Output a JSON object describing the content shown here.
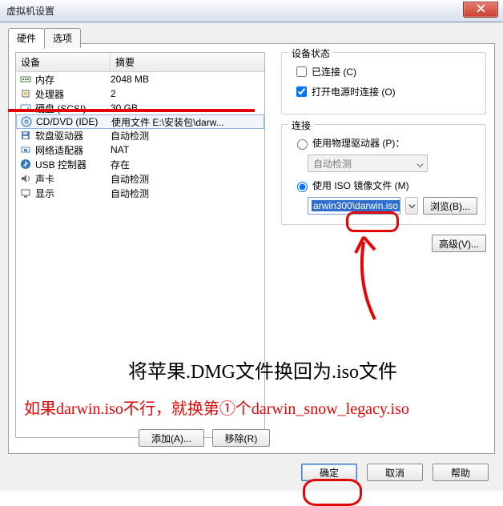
{
  "window": {
    "title": "虚拟机设置"
  },
  "tabs": {
    "hardware": "硬件",
    "options": "选项"
  },
  "device_list": {
    "head_device": "设备",
    "head_summary": "摘要",
    "rows": [
      {
        "name": "内存",
        "summary": "2048 MB",
        "icon": "memory-icon"
      },
      {
        "name": "处理器",
        "summary": "2",
        "icon": "cpu-icon"
      },
      {
        "name": "硬盘 (SCSI)",
        "summary": "30 GB",
        "icon": "disk-icon"
      },
      {
        "name": "CD/DVD (IDE)",
        "summary": "使用文件 E:\\安装包\\darw...",
        "icon": "cd-icon",
        "selected": true
      },
      {
        "name": "软盘驱动器",
        "summary": "自动检测",
        "icon": "floppy-icon"
      },
      {
        "name": "网络适配器",
        "summary": "NAT",
        "icon": "nic-icon"
      },
      {
        "name": "USB 控制器",
        "summary": "存在",
        "icon": "usb-icon"
      },
      {
        "name": "声卡",
        "summary": "自动检测",
        "icon": "sound-icon"
      },
      {
        "name": "显示",
        "summary": "自动检测",
        "icon": "display-icon"
      }
    ]
  },
  "right": {
    "status_legend": "设备状态",
    "connected_label": "已连接 (C)",
    "connected_checked": false,
    "connect_on_power_label": "打开电源时连接 (O)",
    "connect_on_power_checked": true,
    "connect_legend": "连接",
    "use_physical_label": "使用物理驱动器 (P)：",
    "physical_value": "自动检测",
    "use_iso_label": "使用 ISO 镜像文件 (M)",
    "iso_value": "arwin300\\darwin.iso",
    "browse_label": "浏览(B)...",
    "advanced_label": "高级(V)..."
  },
  "mid_buttons": {
    "add": "添加(A)...",
    "remove": "移除(R)"
  },
  "dialog_buttons": {
    "ok": "确定",
    "cancel": "取消",
    "help": "帮助"
  },
  "annotations": {
    "line1": "将苹果.DMG文件换回为.iso文件",
    "line2": "如果darwin.iso不行，就换第①个darwin_snow_legacy.iso"
  },
  "colors": {
    "red": "#e30606",
    "sel_bg": "#2f6ecf"
  }
}
